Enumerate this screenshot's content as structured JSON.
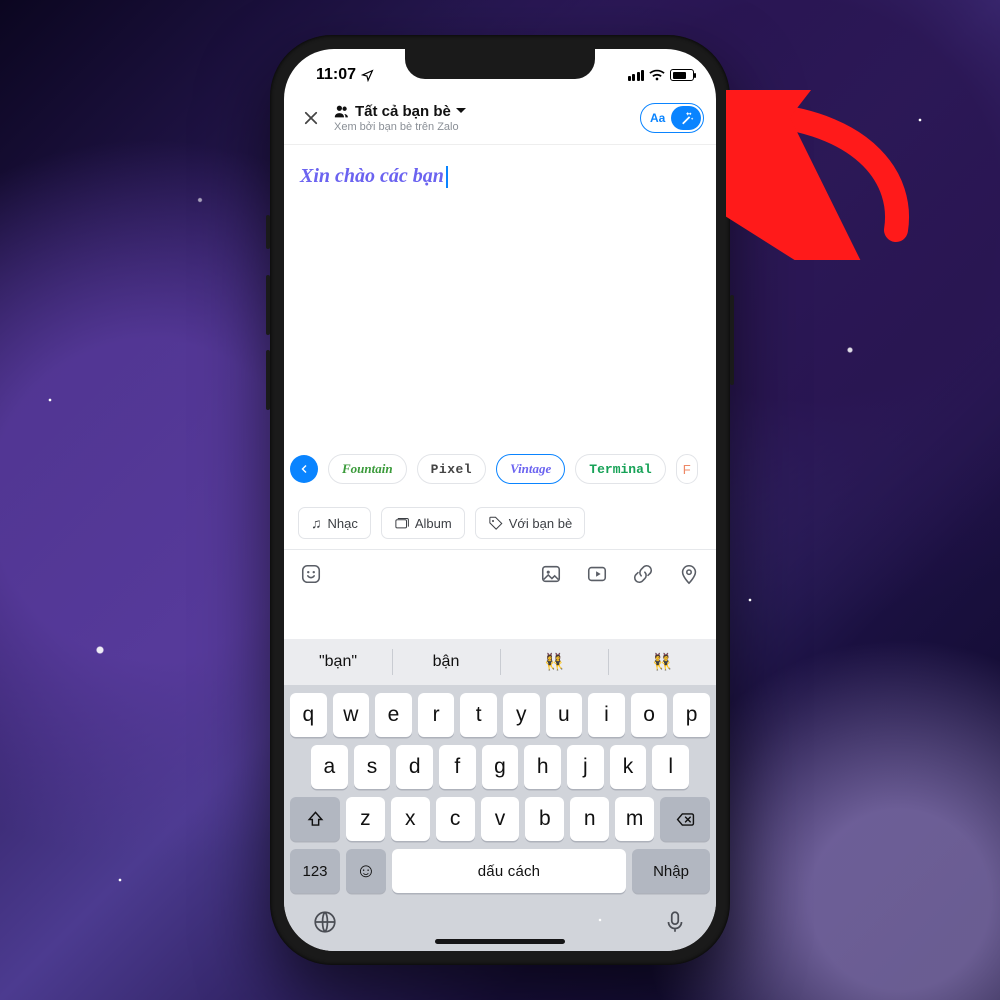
{
  "status": {
    "time": "11:07"
  },
  "header": {
    "audience_title": "Tất cả bạn bè",
    "audience_subtitle": "Xem bởi bạn bè trên Zalo",
    "toggle_left_label": "Aa"
  },
  "compose": {
    "text": "Xin chào các bạn"
  },
  "fonts": [
    "Fountain",
    "Pixel",
    "Vintage",
    "Terminal",
    "F"
  ],
  "selected_font_index": 2,
  "attachments": {
    "music": "Nhạc",
    "album": "Album",
    "with_friends": "Với bạn bè"
  },
  "keyboard": {
    "suggestions": [
      "\"bạn\"",
      "bận",
      "👯‍♀️",
      "👯"
    ],
    "row1": [
      "q",
      "w",
      "e",
      "r",
      "t",
      "y",
      "u",
      "i",
      "o",
      "p"
    ],
    "row2": [
      "a",
      "s",
      "d",
      "f",
      "g",
      "h",
      "j",
      "k",
      "l"
    ],
    "row3": [
      "z",
      "x",
      "c",
      "v",
      "b",
      "n",
      "m"
    ],
    "numbers_label": "123",
    "space_label": "dấu cách",
    "enter_label": "Nhập"
  },
  "colors": {
    "accent_blue": "#0a84ff",
    "font_purple": "#6b63f0",
    "arrow_red": "#ff1a1a"
  }
}
